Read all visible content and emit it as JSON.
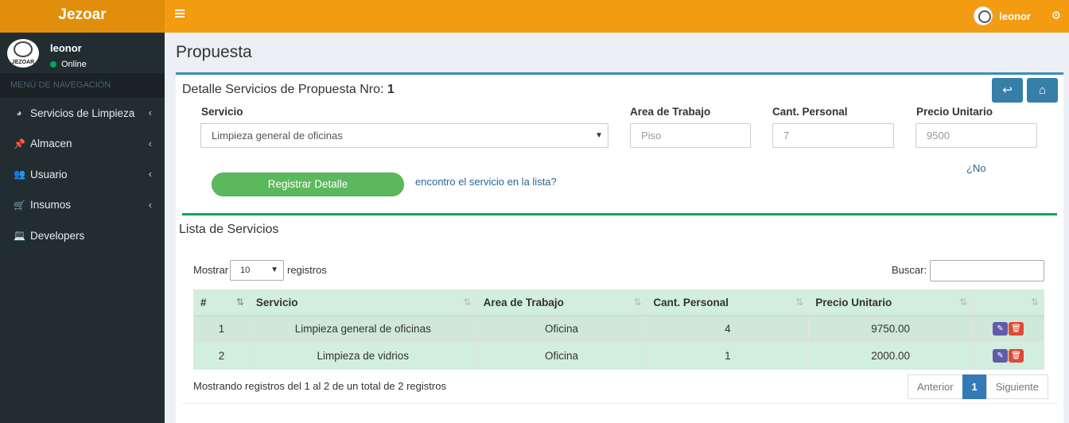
{
  "app": {
    "brand": "Jezoar"
  },
  "navbar": {
    "user_name": "leonor"
  },
  "sidebar": {
    "user": {
      "name": "leonor",
      "status": "Online",
      "avatar_text": "JEZOAR"
    },
    "nav_header": "MENÚ DE NAVEGACIÓN",
    "items": [
      {
        "label": "Servicios de Limpieza",
        "icon": "dashboard-icon",
        "has_children": true
      },
      {
        "label": "Almacen",
        "icon": "pin-icon",
        "has_children": true
      },
      {
        "label": "Usuario",
        "icon": "users-icon",
        "has_children": true
      },
      {
        "label": "Insumos",
        "icon": "cart-icon",
        "has_children": true
      },
      {
        "label": "Developers",
        "icon": "laptop-icon",
        "has_children": false
      }
    ]
  },
  "page": {
    "title": "Propuesta"
  },
  "detail": {
    "title_prefix": "Detalle Servicios de Propuesta Nro:",
    "number": "1",
    "form": {
      "servicio_label": "Servicio",
      "servicio_value": "Limpieza general de oficinas",
      "area_label": "Area de Trabajo",
      "area_placeholder": "Piso",
      "cant_label": "Cant. Personal",
      "cant_placeholder": "7",
      "precio_label": "Precio Unitario",
      "precio_placeholder": "9500"
    },
    "register_button": "Registrar Detalle",
    "no_link": "¿No",
    "help_link": "encontro el servicio en la lista?"
  },
  "list": {
    "title": "Lista de Servicios",
    "length_prefix": "Mostrar",
    "length_value": "10",
    "length_suffix": "registros",
    "search_label": "Buscar:",
    "columns": [
      "#",
      "Servicio",
      "Area de Trabajo",
      "Cant. Personal",
      "Precio Unitario",
      ""
    ],
    "rows": [
      {
        "num": "1",
        "servicio": "Limpieza general de oficinas",
        "area": "Oficina",
        "cant": "4",
        "precio": "9750.00"
      },
      {
        "num": "2",
        "servicio": "Limpieza de vidrios",
        "area": "Oficina",
        "cant": "1",
        "precio": "2000.00"
      }
    ],
    "info": "Mostrando registros del 1 al 2 de un total de 2 registros",
    "pagination": {
      "prev": "Anterior",
      "current": "1",
      "next": "Siguiente"
    }
  },
  "colors": {
    "header": "#f39c12",
    "logo_bg": "#e08e0b",
    "sidebar": "#222d32",
    "box_top": "#3c8dbc",
    "success": "#5cb85c",
    "row_bg": "#d2eedc"
  }
}
